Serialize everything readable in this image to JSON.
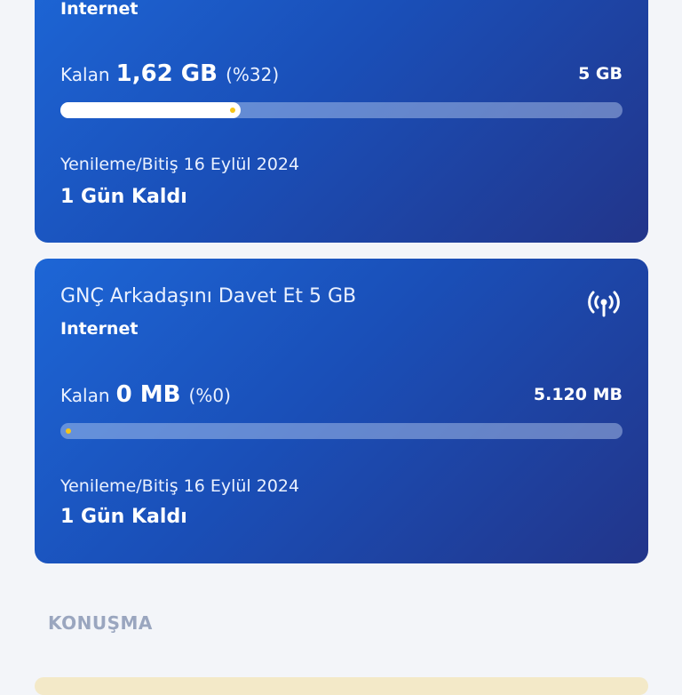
{
  "cards": [
    {
      "type_label": "Internet",
      "remaining_label": "Kalan",
      "remaining_amount": "1,62 GB",
      "remaining_percent": "(%32)",
      "total": "5 GB",
      "progress_fraction": 0.32,
      "renewal_text": "Yenileme/Bitiş 16 Eylül 2024",
      "days_left": "1 Gün Kaldı"
    },
    {
      "title": "GNÇ Arkadaşını Davet Et 5 GB",
      "type_label": "Internet",
      "remaining_label": "Kalan",
      "remaining_amount": "0 MB",
      "remaining_percent": "(%0)",
      "total": "5.120 MB",
      "progress_fraction": 0,
      "renewal_text": "Yenileme/Bitiş 16 Eylül 2024",
      "days_left": "1 Gün Kaldı",
      "icon": "antenna-icon"
    }
  ],
  "sections": {
    "talk_header": "KONUŞMA"
  },
  "colors": {
    "card_gradient_start": "#1d66d6",
    "card_gradient_end": "#22358a",
    "progress_dot": "#f5c518",
    "page_background": "#f3f5f9",
    "section_header": "#9aa6bf"
  }
}
